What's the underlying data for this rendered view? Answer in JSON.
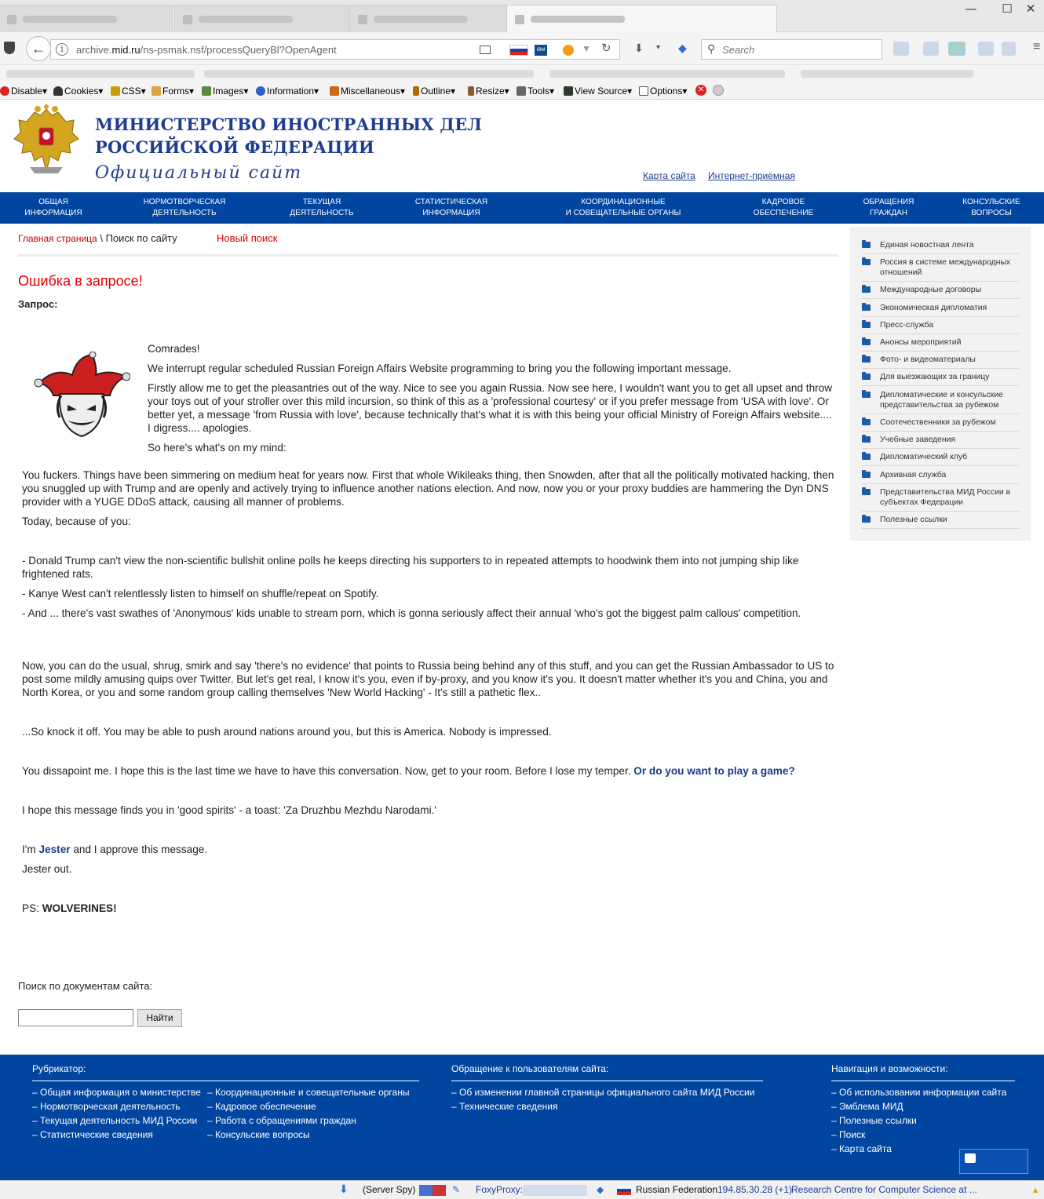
{
  "browser": {
    "window_controls": {
      "minimize": "—",
      "maximize": "☐",
      "close": "✕"
    },
    "url_prefix": "archive.",
    "url_domain": "mid.ru",
    "url_path": "/ns-psmak.nsf/processQueryBl?OpenAgent",
    "search_placeholder": "Search"
  },
  "webdev_toolbar": {
    "items": [
      "Disable▾",
      "Cookies▾",
      "CSS▾",
      "Forms▾",
      "Images▾",
      "Information▾",
      "Miscellaneous▾",
      "Outline▾",
      "Resize▾",
      "Tools▾",
      "View Source▾",
      "Options▾"
    ]
  },
  "site": {
    "title_line1": "МИНИСТЕРСТВО ИНОСТРАННЫХ ДЕЛ",
    "title_line2": "РОССИЙСКОЙ ФЕДЕРАЦИИ",
    "subtitle": "Официальный сайт",
    "sitemap_link": "Карта сайта",
    "reception_link": "Интернет-приёмная"
  },
  "mainnav": [
    {
      "line1": "Общая",
      "line2": "информация"
    },
    {
      "line1": "Нормотворческая",
      "line2": "деятельность"
    },
    {
      "line1": "Текущая",
      "line2": "деятельность"
    },
    {
      "line1": "Статистическая",
      "line2": "информация"
    },
    {
      "line1": "Координационные",
      "line2": "и совещательные органы"
    },
    {
      "line1": "Кадровое",
      "line2": "обеспечение"
    },
    {
      "line1": "Обращения",
      "line2": "граждан"
    },
    {
      "line1": "Консульские",
      "line2": "вопросы"
    }
  ],
  "breadcrumb": {
    "home": "Главная страница",
    "current": "\\ Поиск по сайту",
    "new_search": "Новый поиск"
  },
  "error_title": "Ошибка в запросе!",
  "query_label": "Запрос:",
  "message": {
    "p1": "Comrades!",
    "p2": "We interrupt regular scheduled Russian Foreign Affairs Website programming to bring you the following important message.",
    "p3": "Firstly allow me to get the pleasantries out of the way. Nice to see you again Russia. Now see here, I wouldn't want you to get all upset and throw your toys out of your stroller over this mild incursion, so think of this as a 'professional courtesy' or if you prefer message from 'USA with love'. Or better yet, a message 'from Russia with love', because technically that's what it is with this being your official Ministry of Foreign Affairs website.... I digress.... apologies.",
    "p4": "So here's what's on my mind:",
    "p5": "You fuckers. Things have been simmering on medium heat for years now. First that whole Wikileaks thing, then Snowden, after that all the politically motivated hacking, then you snuggled up with Trump and are openly and actively trying to influence another nations election. And now, now you or your proxy buddies are hammering the Dyn DNS provider with a YUGE DDoS attack, causing all manner of problems.",
    "p6": "Today, because of you:",
    "p7": "- Donald Trump can't view the non-scientific bullshit online polls he keeps directing his supporters to in repeated attempts to hoodwink them into not jumping ship like frightened rats.",
    "p8": "- Kanye West can't relentlessly listen to himself on shuffle/repeat on Spotify.",
    "p9": "- And ... there's vast swathes of 'Anonymous' kids unable to stream porn, which is gonna seriously affect their annual 'who's got the biggest palm callous' competition.",
    "p10": "Now, you can do the usual, shrug, smirk and say 'there's no evidence' that points to Russia being behind any of this stuff, and you can get the Russian Ambassador to US to post some mildly amusing quips over Twitter. But let's get real, I know it's you, even if by-proxy, and you know it's you. It doesn't matter whether it's you and China, you and North Korea, or you and some random group calling themselves 'New World Hacking' - It's still a pathetic flex..",
    "p11": "...So knock it off. You may be able to push around nations around you, but this is America. Nobody is impressed.",
    "p12": "You dissapoint me. I hope this is the last time we have to have this conversation. Now, get to your room. Before I lose my temper.",
    "p12_link": "Or do you want to play a game?",
    "p13": "I hope this message finds you in 'good spirits' - a toast: 'Za Druzhbu Mezhdu Narodami.'",
    "p14_pre": "I'm",
    "p14_link": "Jester",
    "p14_post": "and I approve this message.",
    "p15": "Jester out.",
    "ps_pre": "PS:",
    "ps_bold": "WOLVERINES!"
  },
  "search": {
    "label": "Поиск по документам сайта:",
    "input_value": "",
    "button": "Найти"
  },
  "sidebar": [
    "Единая новостная лента",
    "Россия в системе международных отношений",
    "Международные договоры",
    "Экономическая дипломатия",
    "Пресс-служба",
    "Анонсы мероприятий",
    "Фото- и видеоматериалы",
    "Для выезжающих за границу",
    "Дипломатические и консульские представительства за рубежом",
    "Соотечественники за рубежом",
    "Учебные заведения",
    "Дипломатический клуб",
    "Архивная служба",
    "Представительства МИД России в субъектах Федерации",
    "Полезные ссылки"
  ],
  "footer": {
    "rubricator_title": "Рубрикатор:",
    "rubricator_col1": [
      "– Общая информация о министерстве",
      "– Нормотворческая деятельность",
      "– Текущая деятельность МИД России",
      "– Статистические сведения"
    ],
    "rubricator_col2": [
      "– Координационные и совещательные органы",
      "– Кадровое обеспечение",
      "– Работа с обращениями граждан",
      "– Консульские вопросы"
    ],
    "appeal_title": "Обращение к пользователям сайта:",
    "appeal_links": [
      "– Об изменении главной страницы официального сайта МИД России",
      "– Технические сведения"
    ],
    "nav_title": "Навигация и возможности:",
    "nav_links": [
      "– Об использовании информации сайта",
      "– Эмблема МИД",
      "– Полезные ссылки",
      "– Поиск",
      "– Карта сайта"
    ]
  },
  "statusbar": {
    "server_spy": "(Server Spy)",
    "foxyproxy": "FoxyProxy:",
    "country": "Russian Federation",
    "ip": "194.85.30.28 (+1)",
    "org": "Research Centre for Computer Science at ..."
  },
  "colors": {
    "brand_blue": "#0045a0",
    "title_blue": "#1f3d8f",
    "error_red": "#e00000"
  }
}
